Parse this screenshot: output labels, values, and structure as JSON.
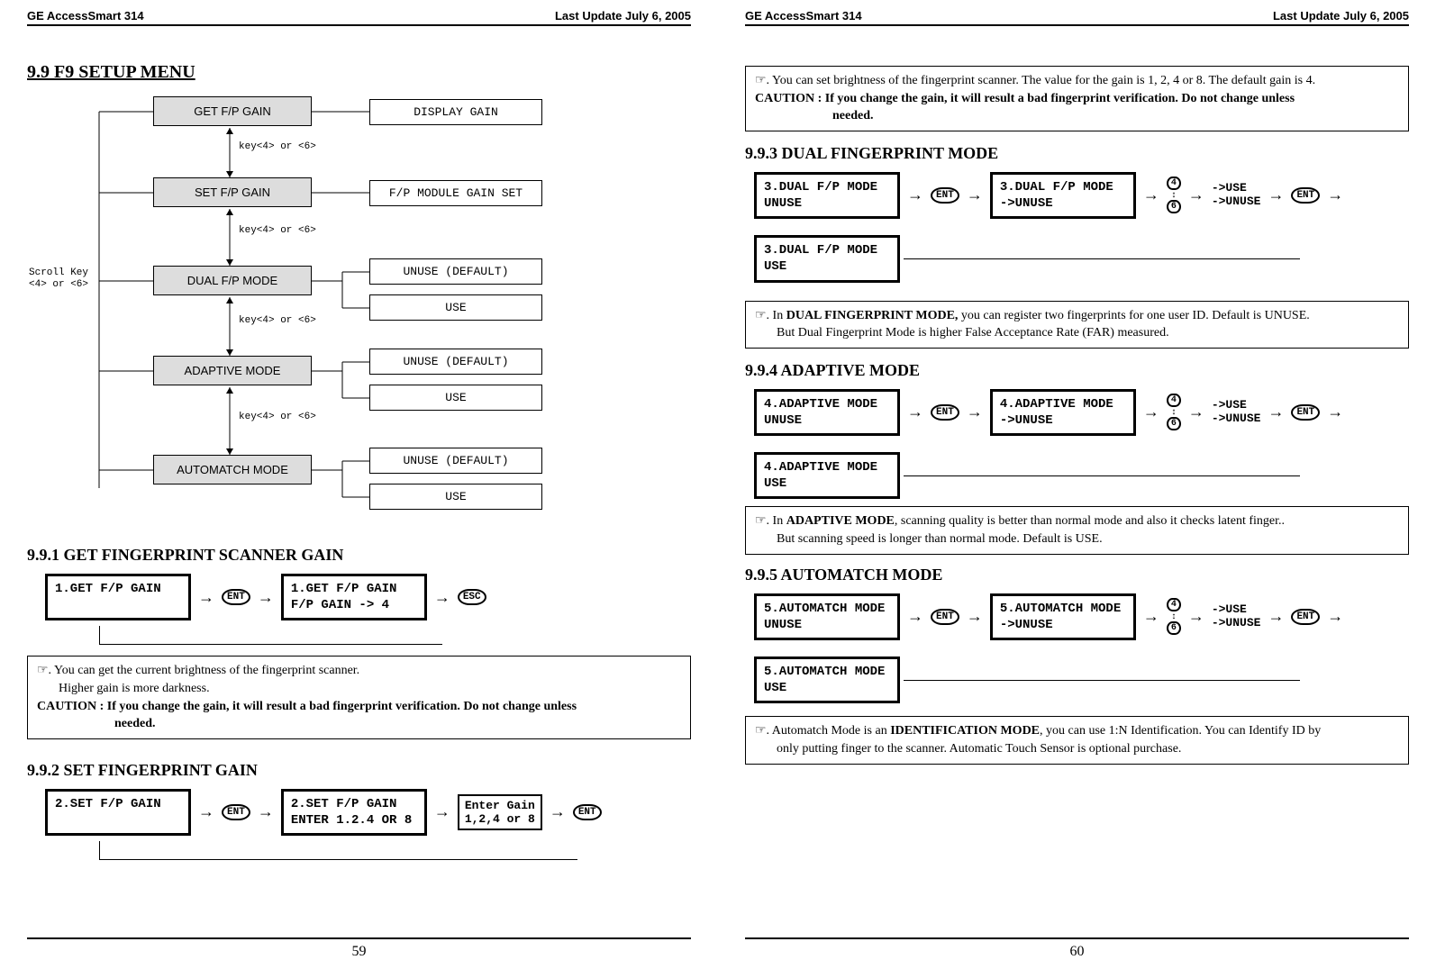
{
  "header": {
    "title": "GE AccessSmart 314",
    "update": "Last Update July 6, 2005"
  },
  "left": {
    "page_num": "59",
    "main_title": "9.9 F9 SETUP MENU",
    "tree": {
      "scroll_label_l1": "Scroll Key",
      "scroll_label_l2": "<4> or <6>",
      "menu1": "GET F/P GAIN",
      "opt1": "DISPLAY GAIN",
      "key_label": "key<4> or <6>",
      "menu2": "SET F/P GAIN",
      "opt2": "F/P MODULE GAIN SET",
      "menu3": "DUAL F/P MODE",
      "opt3a": "UNUSE (DEFAULT)",
      "opt3b": "USE",
      "menu4": "ADAPTIVE MODE",
      "opt4a": "UNUSE (DEFAULT)",
      "opt4b": "USE",
      "menu5": "AUTOMATCH MODE",
      "opt5a": "UNUSE (DEFAULT)",
      "opt5b": "USE"
    },
    "sec991_title": "9.9.1 GET FINGERPRINT SCANNER GAIN",
    "sec991": {
      "lcd1": "1.GET F/P GAIN",
      "ent": "ENT",
      "lcd2_l1": "1.GET F/P GAIN",
      "lcd2_l2": "F/P GAIN -> 4",
      "esc": "ESC"
    },
    "note991_l1": "☞. You can get the current brightness of the fingerprint scanner.",
    "note991_l2": "Higher gain is more darkness.",
    "note991_l3a": "CAUTION : If you change the gain, it will result a bad fingerprint verification. Do not change unless",
    "note991_l3b": "needed.",
    "sec992_title": "9.9.2 SET FINGERPRINT GAIN",
    "sec992": {
      "lcd1": "2.SET F/P GAIN",
      "ent": "ENT",
      "lcd2_l1": "2.SET F/P GAIN",
      "lcd2_l2": "ENTER 1.2.4 OR 8",
      "lcd3_l1": "Enter Gain",
      "lcd3_l2": "1,2,4 or 8"
    }
  },
  "right": {
    "page_num": "60",
    "note_top_l1": "☞. You can set brightness of the fingerprint scanner. The value for the gain is 1, 2, 4 or 8. The default gain is 4.",
    "note_top_l2a": "CAUTION : If you change the gain, it will result a bad fingerprint verification. Do not change unless",
    "note_top_l2b": "needed.",
    "sec993_title": "9.9.3 DUAL FINGERPRINT MODE",
    "sec993": {
      "lcd1_l1": "3.DUAL F/P MODE",
      "lcd1_l2": "UNUSE",
      "ent": "ENT",
      "lcd2_l1": "3.DUAL F/P MODE",
      "lcd2_l2": "->UNUSE",
      "k4": "4",
      "k6": "6",
      "opt_l1": "->USE",
      "opt_l2": "->UNUSE",
      "lcd3_l1": "3.DUAL F/P MODE",
      "lcd3_l2": "USE"
    },
    "note993_l1a": "☞. In ",
    "note993_l1b": "DUAL FINGERPRINT MODE,",
    "note993_l1c": " you can register two fingerprints for one user ID. Default is UNUSE.",
    "note993_l2": "But Dual Fingerprint Mode is higher False Acceptance Rate (FAR) measured.",
    "sec994_title": "9.9.4 ADAPTIVE MODE",
    "sec994": {
      "lcd1_l1": "4.ADAPTIVE MODE",
      "lcd1_l2": "UNUSE",
      "ent": "ENT",
      "lcd2_l1": "4.ADAPTIVE MODE",
      "lcd2_l2": "->UNUSE",
      "k4": "4",
      "k6": "6",
      "opt_l1": "->USE",
      "opt_l2": "->UNUSE",
      "lcd3_l1": "4.ADAPTIVE MODE",
      "lcd3_l2": "USE"
    },
    "note994_l1a": "☞. In ",
    "note994_l1b": "ADAPTIVE MODE",
    "note994_l1c": ", scanning quality is better than normal mode and also it checks latent finger..",
    "note994_l2": "But scanning speed is longer than normal mode. Default is USE.",
    "sec995_title": "9.9.5 AUTOMATCH MODE",
    "sec995": {
      "lcd1_l1": "5.AUTOMATCH MODE",
      "lcd1_l2": "UNUSE",
      "ent": "ENT",
      "lcd2_l1": "5.AUTOMATCH MODE",
      "lcd2_l2": "->UNUSE",
      "k4": "4",
      "k6": "6",
      "opt_l1": "->USE",
      "opt_l2": "->UNUSE",
      "lcd3_l1": "5.AUTOMATCH MODE",
      "lcd3_l2": "USE"
    },
    "note995_l1a": "☞. Automatch Mode is an ",
    "note995_l1b": "IDENTIFICATION MODE",
    "note995_l1c": ", you can use 1:N Identification. You can Identify ID by",
    "note995_l2": "only putting finger to the scanner. Automatic Touch Sensor is optional purchase."
  }
}
